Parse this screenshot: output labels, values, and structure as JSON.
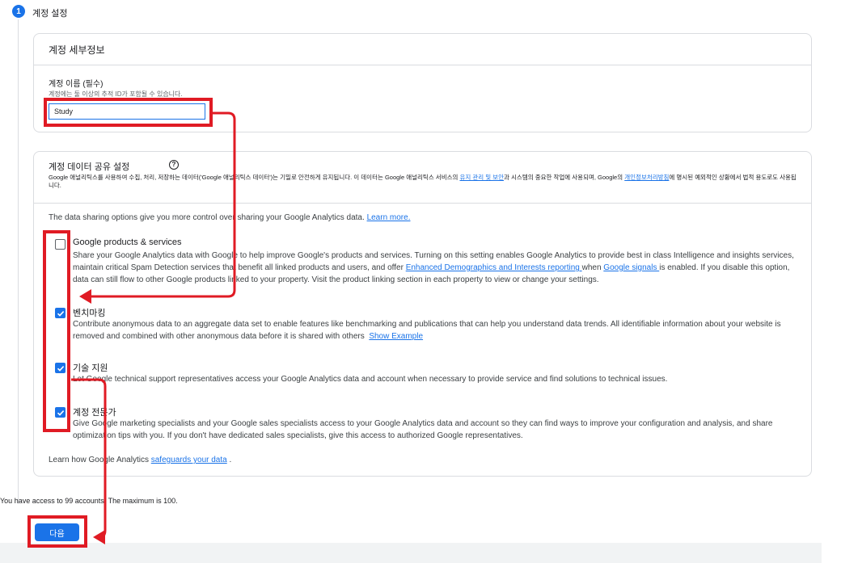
{
  "step": {
    "number": "1",
    "title": "계정 설정"
  },
  "account_details": {
    "header": "계정 세부정보",
    "name_label": "계정 이름 (필수)",
    "name_hint": "계정에는 둘 이상의 추적 ID가 포함될 수 있습니다.",
    "name_value": "Study"
  },
  "data_sharing": {
    "header": "계정 데이터 공유 설정",
    "description_pre": "Google 애널리틱스를 사용하여 수집, 처리, 저장하는 데이터('Google 애널리틱스 데이터')는 기밀로 안전하게 유지됩니다. 이 데이터는 Google 애널리틱스 서비스의 ",
    "description_link1": "유지 관리 및 보안",
    "description_mid": "과 시스템의 중요한 작업에 사용되며, Google의 ",
    "description_link2": "개인정보처리방침",
    "description_post": "에 명시된 예외적인 상황에서 법적 용도로도 사용됩니다.",
    "intro_text": "The data sharing options give you more control over sharing your Google Analytics data.",
    "intro_link": "Learn more.",
    "options": [
      {
        "title": "Google products & services",
        "checked": false,
        "body_pre": "Share your Google Analytics data with Google to help improve Google's products and services. Turning on this setting enables Google Analytics to provide best in class Intelligence and insights services, maintain critical Spam Detection services that benefit all linked products and users, and offer ",
        "body_link1": "Enhanced Demographics and Interests reporting ",
        "body_mid": "when ",
        "body_link2": "Google signals ",
        "body_post": "is enabled. If you disable this option, data can still flow to other Google products linked to your property. Visit the product linking section in each property to view or change your settings."
      },
      {
        "title": "벤치마킹",
        "checked": true,
        "body_pre": "Contribute anonymous data to an aggregate data set to enable features like benchmarking and publications that can help you understand data trends. All identifiable information about your website is removed and combined with other anonymous data before it is shared with others",
        "body_link1": "Show Example"
      },
      {
        "title": "기술 지원",
        "checked": true,
        "body_pre": "Let Google technical support representatives access your Google Analytics data and account when necessary to provide service and find solutions to technical issues."
      },
      {
        "title": "계정 전문가",
        "checked": true,
        "body_pre": "Give Google marketing specialists and your Google sales specialists access to your Google Analytics data and account so they can find ways to improve your configuration and analysis, and share optimization tips with you. If you don't have dedicated sales specialists, give this access to authorized Google representatives."
      }
    ],
    "learn_pre": "Learn how Google Analytics ",
    "learn_link": "safeguards your data",
    "learn_post": " ."
  },
  "access_text": "You have access to 99 accounts. The maximum is 100.",
  "next_button": "다음",
  "colors": {
    "accent": "#1a73e8",
    "annotation": "#e01b24"
  }
}
